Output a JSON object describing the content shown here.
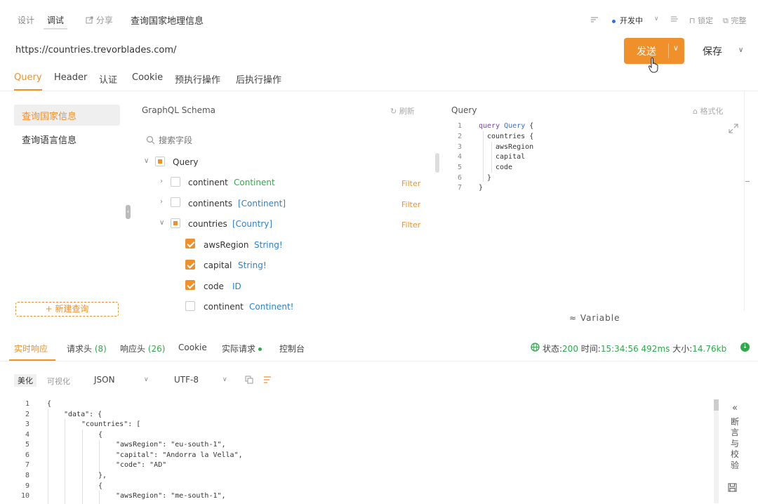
{
  "topbar": {
    "tabs": [
      "设计",
      "调试"
    ],
    "share_label": "分享",
    "title": "查询国家地理信息",
    "env_label": "开发中",
    "lock_label": "锁定",
    "complete_label": "完整"
  },
  "request": {
    "url": "https://countries.trevorblades.com/",
    "send_label": "发送",
    "save_label": "保存",
    "tabs": [
      "Query",
      "Header",
      "认证",
      "Cookie",
      "预执行操作",
      "后执行操作"
    ]
  },
  "operations": {
    "items": [
      "查询国家信息",
      "查询语言信息"
    ],
    "new_query_label": "+ 新建查询"
  },
  "schema": {
    "title": "GraphQL Schema",
    "refresh_label": "刷新",
    "search_placeholder": "搜索字段",
    "root": "Query",
    "filter_label": "Filter",
    "fields": [
      {
        "name": "continent",
        "type": "Continent"
      },
      {
        "name": "continents",
        "type": "[Continent]"
      },
      {
        "name": "countries",
        "type": "[Country]"
      },
      {
        "name": "awsRegion",
        "type": "String!"
      },
      {
        "name": "capital",
        "type": "String!"
      },
      {
        "name": "code",
        "type": "ID!"
      },
      {
        "name": "continent",
        "type": "Continent!"
      }
    ]
  },
  "query_editor": {
    "title": "Query",
    "format_label": "格式化",
    "line_numbers": [
      "1",
      "2",
      "3",
      "4",
      "5",
      "6",
      "7"
    ],
    "line1_kw": "query",
    "line1_name": "Query",
    "line1_brace": "{",
    "lines": [
      "countries {",
      "awsRegion",
      "capital",
      "code",
      "}",
      "}"
    ],
    "variable_label": "Variable"
  },
  "response": {
    "tabs": [
      "实时响应",
      "请求头",
      "响应头",
      "Cookie",
      "实际请求",
      "控制台"
    ],
    "req_header_count": "(8)",
    "resp_header_count": "(26)",
    "status_label": "状态:",
    "status_code": "200",
    "time_label": "时间:",
    "time_value": "15:34:56 492ms",
    "size_label": "大小:",
    "size_value": "14.76kb",
    "view_tabs": [
      "美化",
      "可视化"
    ],
    "format_select": "JSON",
    "encoding_select": "UTF-8",
    "line_numbers": [
      "1",
      "2",
      "3",
      "4",
      "5",
      "6",
      "7",
      "8",
      "9",
      "10"
    ],
    "json_lines": [
      "{",
      "\"data\": {",
      "\"countries\": [",
      "{",
      "\"awsRegion\": \"eu-south-1\",",
      "\"capital\": \"Andorra la Vella\",",
      "\"code\": \"AD\"",
      "},",
      "{",
      "\"awsRegion\": \"me-south-1\","
    ],
    "assert_label": "断言与校验"
  }
}
